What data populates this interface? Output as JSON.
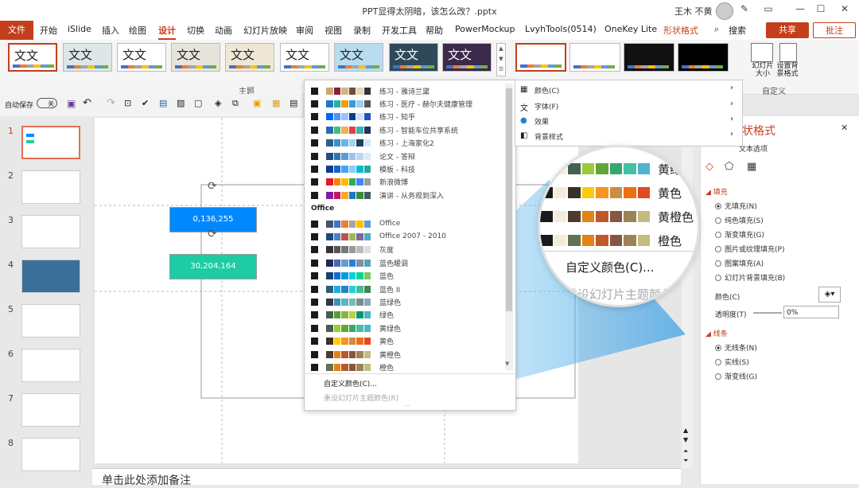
{
  "window": {
    "title": "PPT显得太阴暗，该怎么改？.pptx",
    "user": "王木 不黄",
    "min_icon": "minimize-icon",
    "max_icon": "maximize-icon",
    "close_icon": "close-icon"
  },
  "tabs": [
    "文件",
    "开始",
    "iSlide",
    "插入",
    "绘图",
    "设计",
    "切换",
    "动画",
    "幻灯片放映",
    "审阅",
    "视图",
    "录制",
    "开发工具",
    "帮助",
    "PowerMockup",
    "LvyhTools(0514)",
    "OneKey Lite",
    "形状格式"
  ],
  "search": "搜索",
  "share": "共享",
  "comment": "批注",
  "ribbon": {
    "theme_sample": "文文",
    "group_theme": "主题",
    "group_custom": "自定义",
    "slide_size": "幻灯片大小",
    "format_bg": "设置背景格式"
  },
  "quickbar": {
    "autosave": "自动保存",
    "toggle": "关"
  },
  "slides": [
    "1",
    "2",
    "3",
    "4",
    "5",
    "6",
    "7",
    "8"
  ],
  "shapes": {
    "box1": "0,136,255",
    "box2": "30,204,164"
  },
  "notes": "单击此处添加备注",
  "dropdown": {
    "palettes_top": [
      {
        "name": "练习 - 雅诗兰黛",
        "colors": [
          "#1a1a1a",
          "#ffffff",
          "#c9a96e",
          "#8b1e3f",
          "#d4b483",
          "#6b4f3a",
          "#e8d5b7",
          "#333333"
        ]
      },
      {
        "name": "练习 - 医疗 - 赫尔夫健康管理",
        "colors": [
          "#1a1a1a",
          "#ffffff",
          "#1f7ac7",
          "#2ab0a0",
          "#f39c12",
          "#3a9ad9",
          "#9bd1f0",
          "#555555"
        ]
      },
      {
        "name": "练习 - 知乎",
        "colors": [
          "#1a1a1a",
          "#ffffff",
          "#0066ff",
          "#4d94ff",
          "#99c2ff",
          "#003d99",
          "#cce0ff",
          "#2050c0"
        ]
      },
      {
        "name": "练习 - 智能车位共享系统",
        "colors": [
          "#1a1a1a",
          "#ffffff",
          "#2b6cb0",
          "#48bb78",
          "#f6ad55",
          "#e53e3e",
          "#38b2ac",
          "#1a365d"
        ]
      },
      {
        "name": "练习 - 上海家化2",
        "colors": [
          "#1a1a1a",
          "#ffffff",
          "#2c5e8a",
          "#3d8fc4",
          "#6cb4e0",
          "#a3d2f0",
          "#1e3f5e",
          "#cfe8f7"
        ]
      },
      {
        "name": "论文 - 答辩",
        "colors": [
          "#1a1a1a",
          "#ffffff",
          "#1f4e79",
          "#2e75b6",
          "#5b9bd5",
          "#9dc3e6",
          "#bdd7ee",
          "#deebf7"
        ]
      },
      {
        "name": "模板 - 科技",
        "colors": [
          "#1a1a1a",
          "#ffffff",
          "#0b3d91",
          "#1565c0",
          "#42a5f5",
          "#90caf9",
          "#00bcd4",
          "#26a69a"
        ]
      },
      {
        "name": "新浪微博",
        "colors": [
          "#1a1a1a",
          "#ffffff",
          "#e6162d",
          "#ff8200",
          "#fbbc05",
          "#34a853",
          "#4285f4",
          "#9e9e9e"
        ]
      },
      {
        "name": "演讲 - 从务观到深入",
        "colors": [
          "#1a1a1a",
          "#ffffff",
          "#7b1fa2",
          "#c2185b",
          "#f9a825",
          "#1976d2",
          "#388e3c",
          "#455a64"
        ]
      }
    ],
    "office_header": "Office",
    "palettes_office": [
      {
        "name": "Office",
        "colors": [
          "#1a1a1a",
          "#ffffff",
          "#44546a",
          "#4472c4",
          "#ed7d31",
          "#a5a5a5",
          "#ffc000",
          "#5b9bd5"
        ]
      },
      {
        "name": "Office 2007 - 2010",
        "colors": [
          "#1a1a1a",
          "#ffffff",
          "#1f497d",
          "#4f81bd",
          "#c0504d",
          "#9bbb59",
          "#8064a2",
          "#4bacc6"
        ]
      },
      {
        "name": "灰度",
        "colors": [
          "#1a1a1a",
          "#ffffff",
          "#333333",
          "#555555",
          "#777777",
          "#999999",
          "#bbbbbb",
          "#dddddd"
        ]
      },
      {
        "name": "蓝色暖调",
        "colors": [
          "#1a1a1a",
          "#ffffff",
          "#242852",
          "#4a66ac",
          "#629dd1",
          "#297fd5",
          "#7f8fa9",
          "#5aa2ae"
        ]
      },
      {
        "name": "蓝色",
        "colors": [
          "#1a1a1a",
          "#ffffff",
          "#17406d",
          "#0f6fc6",
          "#009dd9",
          "#0bd0d9",
          "#10cf9b",
          "#7cca62"
        ]
      },
      {
        "name": "蓝色 II",
        "colors": [
          "#1a1a1a",
          "#ffffff",
          "#335b74",
          "#1cade4",
          "#2683c6",
          "#27ced7",
          "#42ba97",
          "#3e8853"
        ]
      },
      {
        "name": "蓝绿色",
        "colors": [
          "#1a1a1a",
          "#ffffff",
          "#373545",
          "#3494ba",
          "#58b6c0",
          "#75bda7",
          "#7a8c8e",
          "#84acb6"
        ]
      },
      {
        "name": "绿色",
        "colors": [
          "#1a1a1a",
          "#ffffff",
          "#455f51",
          "#549e39",
          "#8ab833",
          "#c0cf3a",
          "#029676",
          "#4ab5c4"
        ]
      },
      {
        "name": "黄绿色",
        "colors": [
          "#1a1a1a",
          "#ffffff",
          "#455f51",
          "#99cb38",
          "#63a537",
          "#37a76f",
          "#44c1a3",
          "#4eb3cf"
        ]
      },
      {
        "name": "黄色",
        "colors": [
          "#1a1a1a",
          "#ffffff",
          "#39302a",
          "#ffca08",
          "#f8931d",
          "#ce8d3e",
          "#ec7016",
          "#e64823"
        ]
      },
      {
        "name": "黄橙色",
        "colors": [
          "#1a1a1a",
          "#ffffff",
          "#4e3b30",
          "#e48312",
          "#bd582c",
          "#865640",
          "#9b8357",
          "#c2bc80"
        ]
      },
      {
        "name": "橙色",
        "colors": [
          "#1a1a1a",
          "#ffffff",
          "#637052",
          "#e48312",
          "#bd582c",
          "#865640",
          "#9b8357",
          "#c2bc80"
        ]
      }
    ],
    "custom_colors": "自定义颜色(C)...",
    "reset_colors": "重设幻灯片主题颜色(R)"
  },
  "submenu": {
    "items": [
      {
        "label": "颜色(C)",
        "icon": "color-palette-icon"
      },
      {
        "label": "字体(F)",
        "icon": "font-icon"
      },
      {
        "label": "效果",
        "icon": "effects-icon"
      },
      {
        "label": "背景样式",
        "icon": "background-style-icon"
      }
    ]
  },
  "magnifier": {
    "rows": [
      {
        "name": "黄绿色",
        "colors": [
          "#455f51",
          "#99cb38",
          "#63a537",
          "#37a76f",
          "#44c1a3",
          "#4eb3cf"
        ]
      },
      {
        "name": "黄色",
        "colors": [
          "#39302a",
          "#ffca08",
          "#f8931d",
          "#ce8d3e",
          "#ec7016",
          "#e64823"
        ]
      },
      {
        "name": "黄橙色",
        "colors": [
          "#4e3b30",
          "#e48312",
          "#bd582c",
          "#865640",
          "#9b8357",
          "#c2bc80"
        ]
      },
      {
        "name": "橙色",
        "colors": [
          "#637052",
          "#e48312",
          "#bd582c",
          "#865640",
          "#9b8357",
          "#c2bc80"
        ]
      }
    ],
    "custom": "自定义颜色(C)...",
    "reset": "重设幻灯片主题颜色(R)"
  },
  "format_panel": {
    "title": "状格式",
    "subtitle": "文本选项",
    "fill_header": "填充",
    "fill_options": [
      "无填充(N)",
      "纯色填充(S)",
      "渐变填充(G)",
      "图片或纹理填充(P)",
      "图案填充(A)",
      "幻灯片背景填充(B)"
    ],
    "color_label": "颜色(C)",
    "transparency_label": "透明度(T)",
    "transparency_value": "0%",
    "line_header": "线条",
    "line_options": [
      "无线条(N)",
      "实线(S)",
      "渐变线(G)"
    ]
  },
  "colors": {
    "accent": "#c43e1c",
    "box1": "#0088ff",
    "box2": "#1ecca4"
  }
}
